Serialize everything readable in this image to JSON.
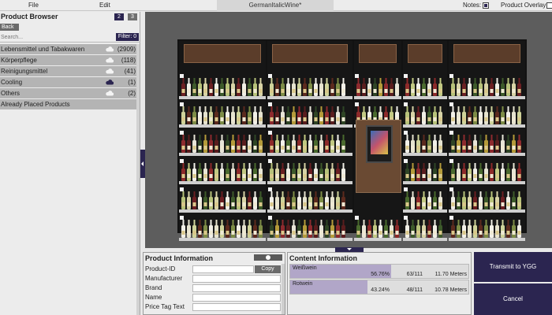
{
  "menubar": {
    "file": "File",
    "edit": "Edit",
    "document_tab": "GermanItalicWine*",
    "notes_label": "Notes:",
    "notes_checked": true,
    "overlay_label": "Product Overlay:",
    "overlay_checked": false
  },
  "product_browser": {
    "title": "Product Browser",
    "view_buttons": [
      "2",
      "3"
    ],
    "back_label": "Back",
    "search_placeholder": "Search...",
    "filter_label": "Filter: 0",
    "categories": [
      {
        "name": "Lebensmittel und Tabakwaren",
        "count": "(2909)",
        "icon": "cloud-icon"
      },
      {
        "name": "Körperpflege",
        "count": "(118)",
        "icon": "cloud-icon"
      },
      {
        "name": "Reinigungsmittel",
        "count": "(41)",
        "icon": "cloud-icon"
      },
      {
        "name": "Cooling",
        "count": "(1)",
        "icon": "cloud-icon"
      },
      {
        "name": "Others",
        "count": "(2)",
        "icon": "cloud-icon"
      }
    ],
    "placed_label": "Already Placed Products"
  },
  "product_information": {
    "title": "Product Information",
    "copy_label": "Copy",
    "fields": [
      {
        "label": "Product-ID",
        "value": ""
      },
      {
        "label": "Manufacturer",
        "value": ""
      },
      {
        "label": "Brand",
        "value": ""
      },
      {
        "label": "Name",
        "value": ""
      },
      {
        "label": "Price Tag Text",
        "value": ""
      }
    ]
  },
  "content_information": {
    "title": "Content Information",
    "rows": [
      {
        "name": "Weißwein",
        "percent": "56.76%",
        "share": 0.5676,
        "count": "63/111",
        "length": "11.70 Meters"
      },
      {
        "name": "Rotwein",
        "percent": "43.24%",
        "share": 0.4324,
        "count": "48/111",
        "length": "10.78 Meters"
      }
    ]
  },
  "actions": {
    "transmit": "Transmit to YGG",
    "cancel": "Cancel"
  },
  "colors": {
    "accent": "#2b2550",
    "fill": "#b1a6c8",
    "shelf_header": "#5b3d2a",
    "cloud": "#2b2550"
  }
}
